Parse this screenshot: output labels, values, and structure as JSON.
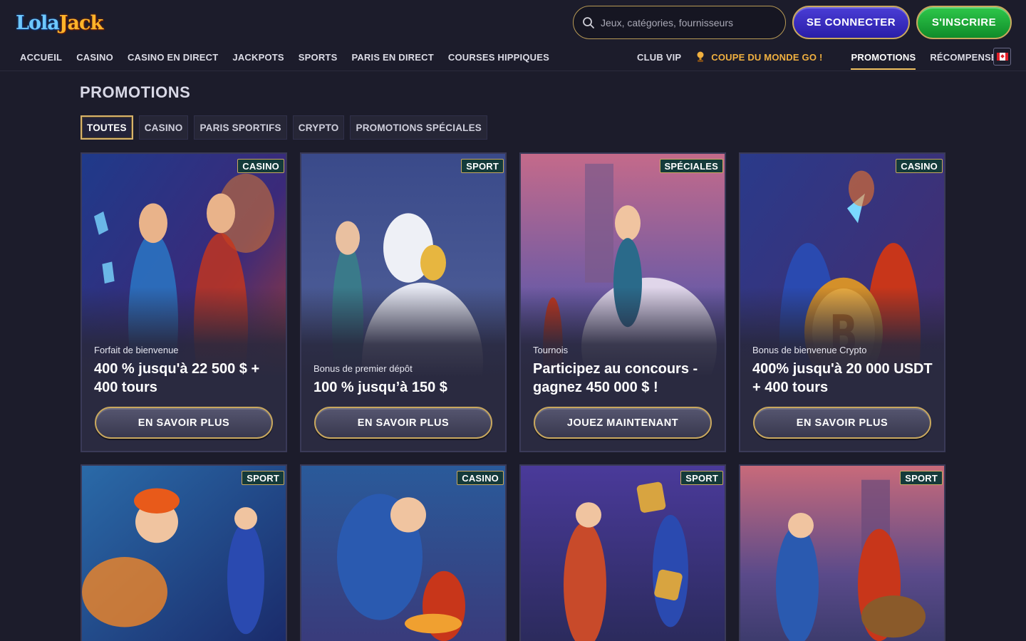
{
  "brand": {
    "logo_part1": "Lola",
    "logo_part2": "Jack"
  },
  "search": {
    "placeholder": "Jeux, catégories, fournisseurs"
  },
  "auth": {
    "login_label": "SE CONNECTER",
    "signup_label": "S'INSCRIRE"
  },
  "nav": {
    "left": [
      "ACCUEIL",
      "CASINO",
      "CASINO EN DIRECT",
      "JACKPOTS",
      "SPORTS",
      "PARIS EN DIRECT",
      "COURSES HIPPIQUES"
    ],
    "right": {
      "vip": "CLUB VIP",
      "worldcup": "COUPE DU MONDE GO !",
      "promotions": "PROMOTIONS",
      "rewards": "RÉCOMPENSES"
    }
  },
  "page": {
    "title": "PROMOTIONS"
  },
  "filters": [
    "TOUTES",
    "CASINO",
    "PARIS SPORTIFS",
    "CRYPTO",
    "PROMOTIONS SPÉCIALES"
  ],
  "cards": [
    {
      "tag": "CASINO",
      "sub": "Forfait de bienvenue",
      "head": "400 % jusqu'à 22 500 $ + 400 tours",
      "cta": "EN SAVOIR PLUS"
    },
    {
      "tag": "SPORT",
      "sub": "Bonus de premier dépôt",
      "head": "100 % jusqu’à 150 $",
      "cta": "EN SAVOIR PLUS"
    },
    {
      "tag": "SPÉCIALES",
      "sub": "Tournois",
      "head": "Participez au concours - gagnez 450 000 $ !",
      "cta": "JOUEZ MAINTENANT"
    },
    {
      "tag": "CASINO",
      "sub": "Bonus de bienvenue Crypto",
      "head": "400% jusqu'à 20 000 USDT + 400 tours",
      "cta": "EN SAVOIR PLUS"
    },
    {
      "tag": "SPORT"
    },
    {
      "tag": "CASINO"
    },
    {
      "tag": "SPORT"
    },
    {
      "tag": "SPORT"
    }
  ]
}
